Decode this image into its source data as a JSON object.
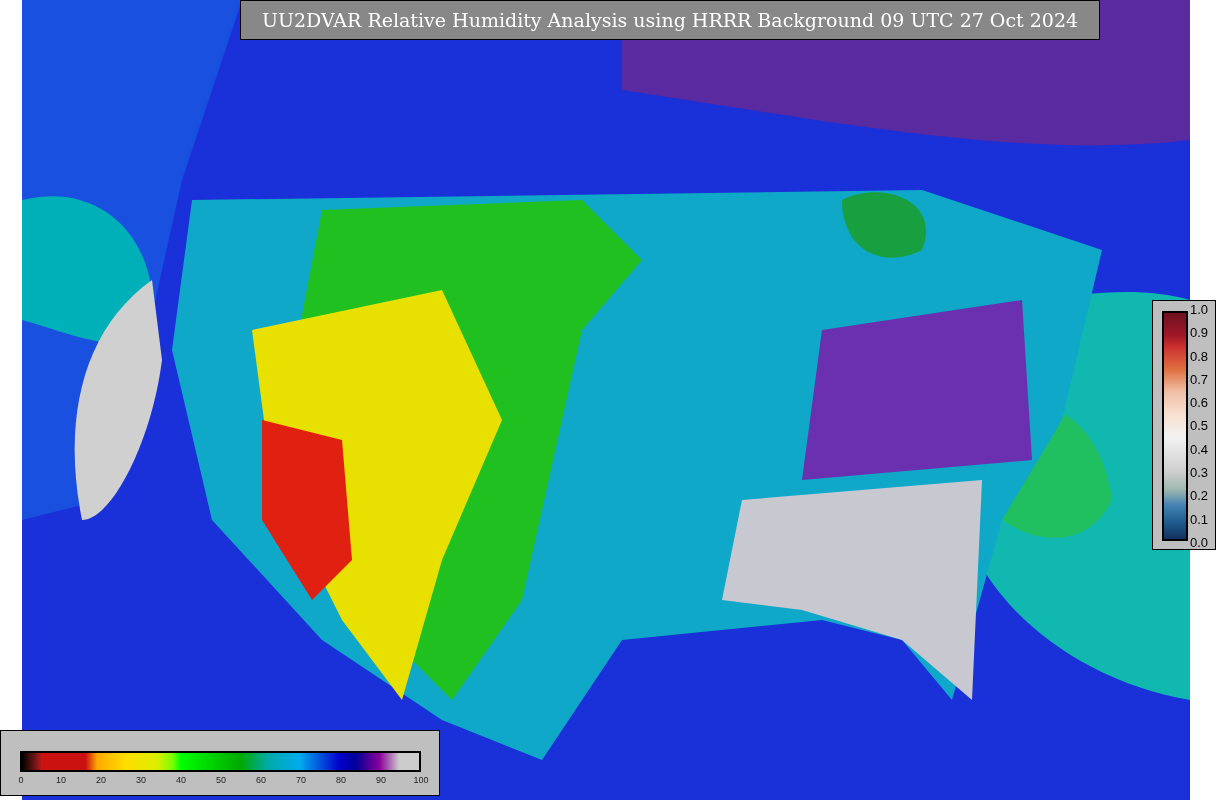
{
  "title": "UU2DVAR Relative Humidity Analysis using HRRR Background 09 UTC 27 Oct 2024",
  "humidity_colorbar": {
    "ticks": [
      "0",
      "10",
      "20",
      "30",
      "40",
      "50",
      "60",
      "70",
      "80",
      "90",
      "100"
    ]
  },
  "ratio_colorbar": {
    "ticks": [
      "1.0",
      "0.9",
      "0.8",
      "0.7",
      "0.6",
      "0.5",
      "0.4",
      "0.3",
      "0.2",
      "0.1",
      "0.0"
    ]
  }
}
